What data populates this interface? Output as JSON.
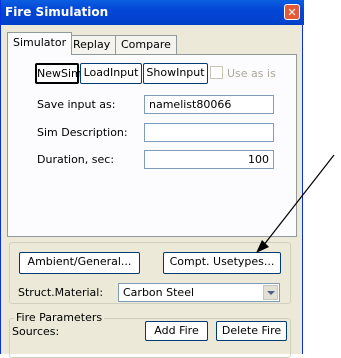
{
  "window": {
    "title": "Fire Simulation",
    "close_glyph": "✕"
  },
  "tabs": [
    {
      "label": "Simulator",
      "active": true
    },
    {
      "label": "Replay",
      "active": false
    },
    {
      "label": "Compare",
      "active": false
    }
  ],
  "toolbar": {
    "newsim_label": "NewSim",
    "loadinput_label": "LoadInput",
    "showinput_label": "ShowInput",
    "use_as_is_label": "Use as is",
    "use_as_is_checked": false
  },
  "form": {
    "save_input_label": "Save input as:",
    "save_input_value": "namelist80066",
    "sim_description_label": "Sim Description:",
    "sim_description_value": "",
    "duration_label": "Duration, sec:",
    "duration_value": "100"
  },
  "settings": {
    "ambient_label": "Ambient/General...",
    "compt_usetypes_label": "Compt. Usetypes...",
    "struct_material_label": "Struct.Material:",
    "struct_material_value": "Carbon Steel"
  },
  "fire_parameters": {
    "legend": "Fire Parameters",
    "sources_label": "Sources:",
    "add_fire_label": "Add Fire",
    "delete_fire_label": "Delete Fire"
  },
  "annotation": {
    "type": "arrow",
    "color": "#000000",
    "points_to": "compt-usetypes-button"
  }
}
